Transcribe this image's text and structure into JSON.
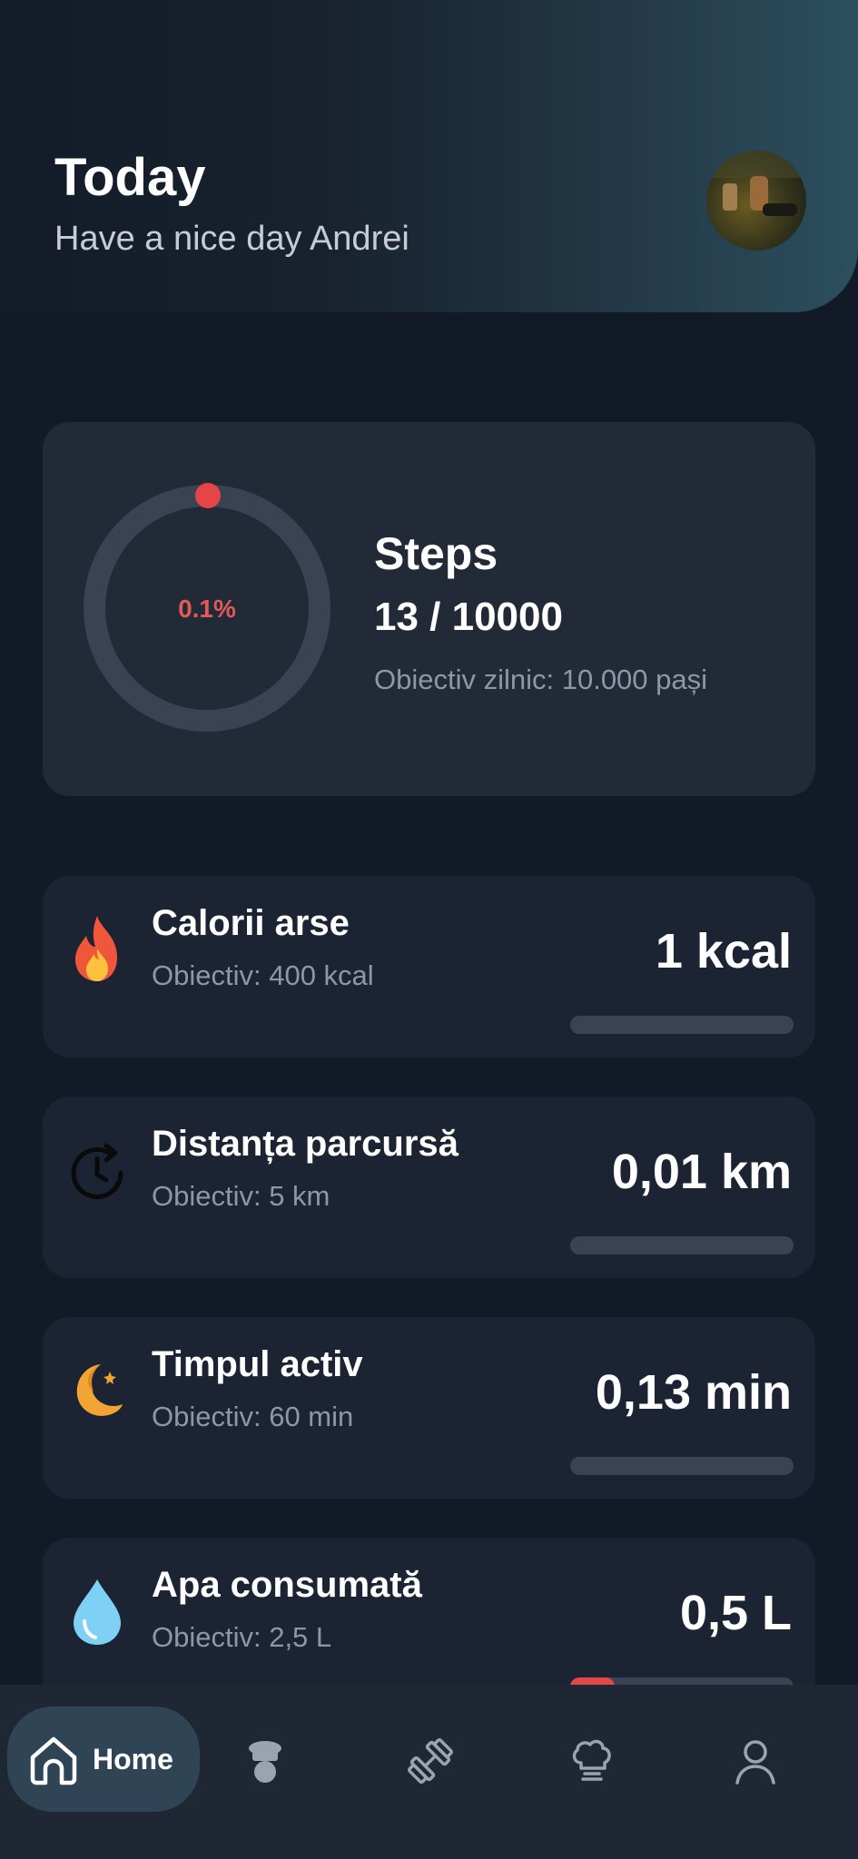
{
  "header": {
    "title": "Today",
    "subtitle": "Have a nice day Andrei"
  },
  "steps": {
    "title": "Steps",
    "count": "13 / 10000",
    "goal": "Obiectiv zilnic: 10.000 pași",
    "percent_label": "0.1%",
    "progress": 0.0013
  },
  "stats": [
    {
      "icon": "fire-icon",
      "title": "Calorii arse",
      "goal": "Obiectiv: 400 kcal",
      "value": "1 kcal",
      "progress": 0.0
    },
    {
      "icon": "clock-icon",
      "title": "Distanța parcursă",
      "goal": "Obiectiv: 5 km",
      "value": "0,01 km",
      "progress": 0.0
    },
    {
      "icon": "moon-icon",
      "title": "Timpul activ",
      "goal": "Obiectiv: 60 min",
      "value": "0,13 min",
      "progress": 0.0
    },
    {
      "icon": "water-drop-icon",
      "title": "Apa consumată",
      "goal": "Obiectiv: 2,5 L",
      "value": "0,5 L",
      "progress": 0.2
    }
  ],
  "nav": {
    "home_label": "Home",
    "items": [
      "home-icon",
      "chef-icon",
      "dumbbell-icon",
      "chef-hat-icon",
      "user-icon"
    ]
  },
  "colors": {
    "background": "#121a27",
    "card": "#1c2433",
    "accent": "#e0484a",
    "ring_track": "#3a4353",
    "muted_text": "#8e97a6"
  }
}
